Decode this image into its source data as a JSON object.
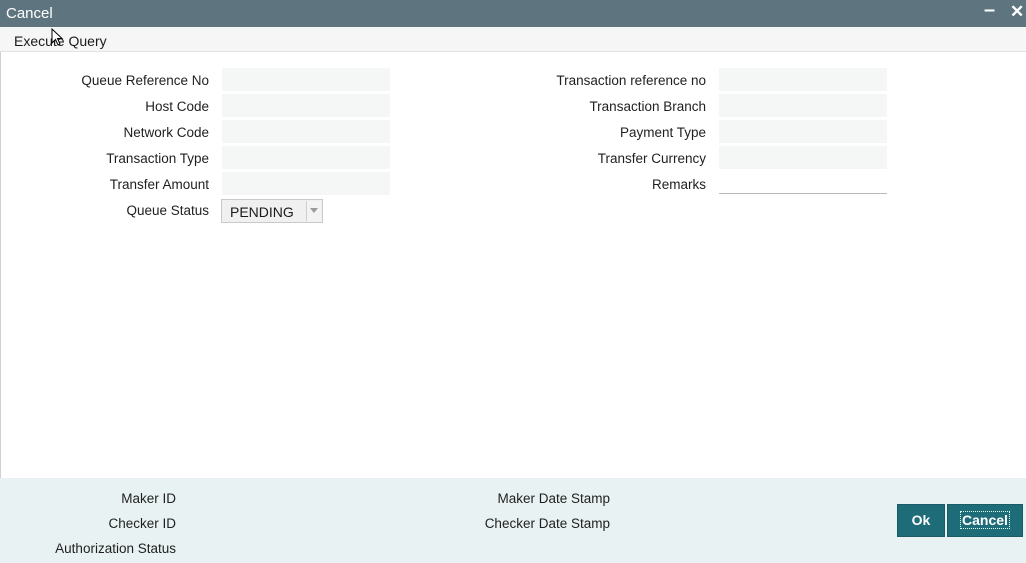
{
  "window": {
    "title": "Cancel",
    "minimize_glyph": "▬",
    "close_glyph": "✕"
  },
  "menubar": {
    "execute_query": "Execute Query"
  },
  "form": {
    "queue_reference_no": {
      "label": "Queue Reference No",
      "value": ""
    },
    "host_code": {
      "label": "Host Code",
      "value": ""
    },
    "network_code": {
      "label": "Network Code",
      "value": ""
    },
    "transaction_type": {
      "label": "Transaction Type",
      "value": ""
    },
    "transfer_amount": {
      "label": "Transfer Amount",
      "value": ""
    },
    "queue_status": {
      "label": "Queue Status",
      "value": "PENDING"
    },
    "transaction_reference_no": {
      "label": "Transaction reference no",
      "value": ""
    },
    "transaction_branch": {
      "label": "Transaction Branch",
      "value": ""
    },
    "payment_type": {
      "label": "Payment Type",
      "value": ""
    },
    "transfer_currency": {
      "label": "Transfer Currency",
      "value": ""
    },
    "remarks": {
      "label": "Remarks",
      "value": ""
    }
  },
  "footer": {
    "maker_id": "Maker ID",
    "checker_id": "Checker ID",
    "authorization_status": "Authorization Status",
    "maker_date_stamp": "Maker Date Stamp",
    "checker_date_stamp": "Checker Date Stamp"
  },
  "buttons": {
    "ok": "Ok",
    "cancel": "Cancel"
  },
  "colors": {
    "titlebar": "#5e7580",
    "footer": "#e9f2f3",
    "button": "#1e6c78"
  }
}
